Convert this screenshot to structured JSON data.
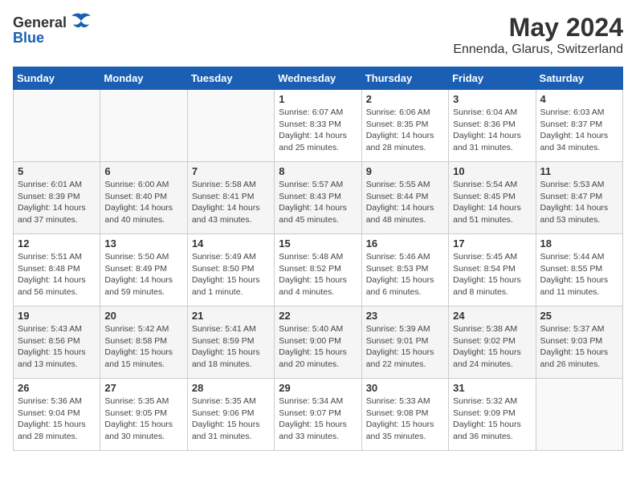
{
  "header": {
    "logo_general": "General",
    "logo_blue": "Blue",
    "month_year": "May 2024",
    "location": "Ennenda, Glarus, Switzerland"
  },
  "weekdays": [
    "Sunday",
    "Monday",
    "Tuesday",
    "Wednesday",
    "Thursday",
    "Friday",
    "Saturday"
  ],
  "weeks": [
    [
      {
        "day": "",
        "info": ""
      },
      {
        "day": "",
        "info": ""
      },
      {
        "day": "",
        "info": ""
      },
      {
        "day": "1",
        "info": "Sunrise: 6:07 AM\nSunset: 8:33 PM\nDaylight: 14 hours\nand 25 minutes."
      },
      {
        "day": "2",
        "info": "Sunrise: 6:06 AM\nSunset: 8:35 PM\nDaylight: 14 hours\nand 28 minutes."
      },
      {
        "day": "3",
        "info": "Sunrise: 6:04 AM\nSunset: 8:36 PM\nDaylight: 14 hours\nand 31 minutes."
      },
      {
        "day": "4",
        "info": "Sunrise: 6:03 AM\nSunset: 8:37 PM\nDaylight: 14 hours\nand 34 minutes."
      }
    ],
    [
      {
        "day": "5",
        "info": "Sunrise: 6:01 AM\nSunset: 8:39 PM\nDaylight: 14 hours\nand 37 minutes."
      },
      {
        "day": "6",
        "info": "Sunrise: 6:00 AM\nSunset: 8:40 PM\nDaylight: 14 hours\nand 40 minutes."
      },
      {
        "day": "7",
        "info": "Sunrise: 5:58 AM\nSunset: 8:41 PM\nDaylight: 14 hours\nand 43 minutes."
      },
      {
        "day": "8",
        "info": "Sunrise: 5:57 AM\nSunset: 8:43 PM\nDaylight: 14 hours\nand 45 minutes."
      },
      {
        "day": "9",
        "info": "Sunrise: 5:55 AM\nSunset: 8:44 PM\nDaylight: 14 hours\nand 48 minutes."
      },
      {
        "day": "10",
        "info": "Sunrise: 5:54 AM\nSunset: 8:45 PM\nDaylight: 14 hours\nand 51 minutes."
      },
      {
        "day": "11",
        "info": "Sunrise: 5:53 AM\nSunset: 8:47 PM\nDaylight: 14 hours\nand 53 minutes."
      }
    ],
    [
      {
        "day": "12",
        "info": "Sunrise: 5:51 AM\nSunset: 8:48 PM\nDaylight: 14 hours\nand 56 minutes."
      },
      {
        "day": "13",
        "info": "Sunrise: 5:50 AM\nSunset: 8:49 PM\nDaylight: 14 hours\nand 59 minutes."
      },
      {
        "day": "14",
        "info": "Sunrise: 5:49 AM\nSunset: 8:50 PM\nDaylight: 15 hours\nand 1 minute."
      },
      {
        "day": "15",
        "info": "Sunrise: 5:48 AM\nSunset: 8:52 PM\nDaylight: 15 hours\nand 4 minutes."
      },
      {
        "day": "16",
        "info": "Sunrise: 5:46 AM\nSunset: 8:53 PM\nDaylight: 15 hours\nand 6 minutes."
      },
      {
        "day": "17",
        "info": "Sunrise: 5:45 AM\nSunset: 8:54 PM\nDaylight: 15 hours\nand 8 minutes."
      },
      {
        "day": "18",
        "info": "Sunrise: 5:44 AM\nSunset: 8:55 PM\nDaylight: 15 hours\nand 11 minutes."
      }
    ],
    [
      {
        "day": "19",
        "info": "Sunrise: 5:43 AM\nSunset: 8:56 PM\nDaylight: 15 hours\nand 13 minutes."
      },
      {
        "day": "20",
        "info": "Sunrise: 5:42 AM\nSunset: 8:58 PM\nDaylight: 15 hours\nand 15 minutes."
      },
      {
        "day": "21",
        "info": "Sunrise: 5:41 AM\nSunset: 8:59 PM\nDaylight: 15 hours\nand 18 minutes."
      },
      {
        "day": "22",
        "info": "Sunrise: 5:40 AM\nSunset: 9:00 PM\nDaylight: 15 hours\nand 20 minutes."
      },
      {
        "day": "23",
        "info": "Sunrise: 5:39 AM\nSunset: 9:01 PM\nDaylight: 15 hours\nand 22 minutes."
      },
      {
        "day": "24",
        "info": "Sunrise: 5:38 AM\nSunset: 9:02 PM\nDaylight: 15 hours\nand 24 minutes."
      },
      {
        "day": "25",
        "info": "Sunrise: 5:37 AM\nSunset: 9:03 PM\nDaylight: 15 hours\nand 26 minutes."
      }
    ],
    [
      {
        "day": "26",
        "info": "Sunrise: 5:36 AM\nSunset: 9:04 PM\nDaylight: 15 hours\nand 28 minutes."
      },
      {
        "day": "27",
        "info": "Sunrise: 5:35 AM\nSunset: 9:05 PM\nDaylight: 15 hours\nand 30 minutes."
      },
      {
        "day": "28",
        "info": "Sunrise: 5:35 AM\nSunset: 9:06 PM\nDaylight: 15 hours\nand 31 minutes."
      },
      {
        "day": "29",
        "info": "Sunrise: 5:34 AM\nSunset: 9:07 PM\nDaylight: 15 hours\nand 33 minutes."
      },
      {
        "day": "30",
        "info": "Sunrise: 5:33 AM\nSunset: 9:08 PM\nDaylight: 15 hours\nand 35 minutes."
      },
      {
        "day": "31",
        "info": "Sunrise: 5:32 AM\nSunset: 9:09 PM\nDaylight: 15 hours\nand 36 minutes."
      },
      {
        "day": "",
        "info": ""
      }
    ]
  ]
}
